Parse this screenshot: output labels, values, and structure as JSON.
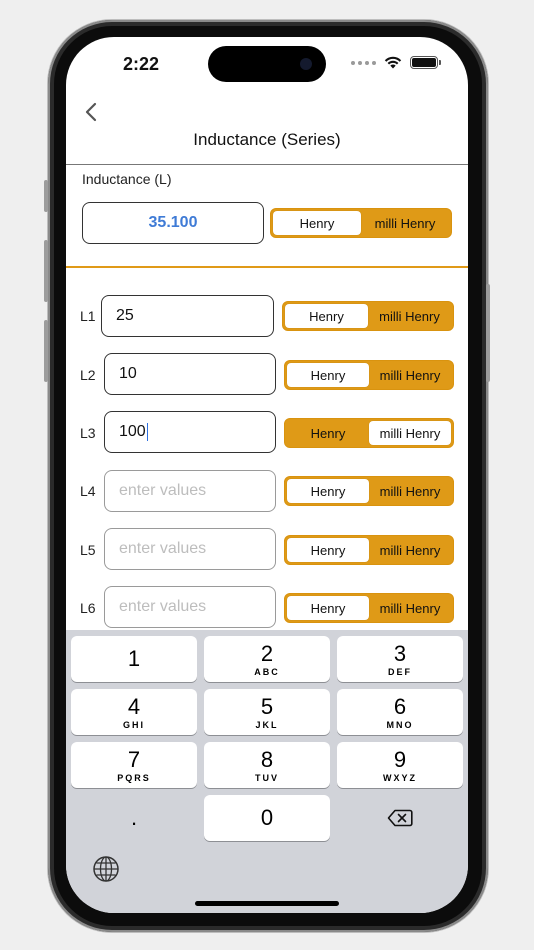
{
  "status": {
    "time": "2:22"
  },
  "nav": {
    "title": "Inductance (Series)"
  },
  "result": {
    "label": "Inductance (L)",
    "value": "35.100",
    "unit_options": [
      "Henry",
      "milli Henry"
    ]
  },
  "inputs": [
    {
      "label": "L1",
      "value": "25",
      "placeholder": "enter values",
      "unit_options": [
        "Henry",
        "milli Henry"
      ],
      "selected_unit": "Henry"
    },
    {
      "label": "L2",
      "value": "10",
      "placeholder": "enter values",
      "unit_options": [
        "Henry",
        "milli Henry"
      ],
      "selected_unit": "Henry"
    },
    {
      "label": "L3",
      "value": "100",
      "placeholder": "enter values",
      "unit_options": [
        "Henry",
        "milli Henry"
      ],
      "selected_unit": "milli Henry"
    },
    {
      "label": "L4",
      "value": "",
      "placeholder": "enter values",
      "unit_options": [
        "Henry",
        "milli Henry"
      ],
      "selected_unit": "Henry"
    },
    {
      "label": "L5",
      "value": "",
      "placeholder": "enter values",
      "unit_options": [
        "Henry",
        "milli Henry"
      ],
      "selected_unit": "Henry"
    },
    {
      "label": "L6",
      "value": "",
      "placeholder": "enter values",
      "unit_options": [
        "Henry",
        "milli Henry"
      ],
      "selected_unit": "Henry"
    }
  ],
  "keyboard": {
    "keys": [
      {
        "num": "1",
        "letters": ""
      },
      {
        "num": "2",
        "letters": "ABC"
      },
      {
        "num": "3",
        "letters": "DEF"
      },
      {
        "num": "4",
        "letters": "GHI"
      },
      {
        "num": "5",
        "letters": "JKL"
      },
      {
        "num": "6",
        "letters": "MNO"
      },
      {
        "num": "7",
        "letters": "PQRS"
      },
      {
        "num": "8",
        "letters": "TUV"
      },
      {
        "num": "9",
        "letters": "WXYZ"
      }
    ],
    "decimal": ".",
    "zero": "0",
    "icons": {
      "delete": "delete-backward-icon",
      "globe": "globe-icon"
    }
  },
  "colors": {
    "accent": "#df9a17",
    "result_text": "#3f7bd6",
    "keyboard_bg": "#d1d3d9"
  }
}
